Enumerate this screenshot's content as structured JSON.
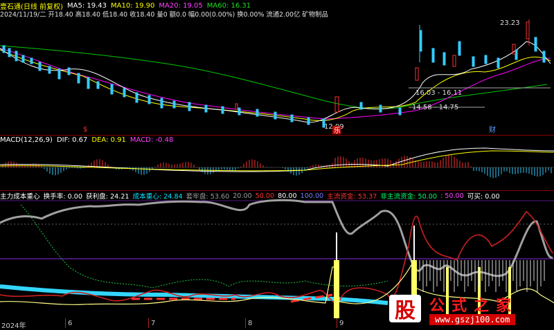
{
  "header": {
    "stock_name": "壹石通(日线 前复权)",
    "ma5": "MA5: 19.43",
    "ma10": "MA10: 19.90",
    "ma20": "MA20: 19.05",
    "ma60": "MA60: 16.31",
    "quote_line": "2024/11/19/二 开18.40 高18.40 低18.40 收18.40 量0 额0.0 幅0.00(0.00%) 换0.00% 流通2.00亿 矿物制品"
  },
  "main_chart": {
    "high_label": "23.23",
    "low_label": "12.09",
    "range_label_1": "16.03 - 16.11",
    "range_label_2": "14.58 - 14.75",
    "event_marks": [
      {
        "label": "$",
        "color": "#ff3030"
      },
      {
        "label": "乐",
        "color": "#ffffff"
      },
      {
        "label": "财",
        "color": "#5aa0ff"
      }
    ],
    "colors": {
      "ma5": "#ffffff",
      "ma10": "#ffff00",
      "ma20": "#ff00ff",
      "ma60": "#00cc00",
      "up": "#ff3030",
      "down": "#33ccff"
    }
  },
  "macd_panel": {
    "title": "MACD(12,26,9)",
    "dif": "DIF: 0.67",
    "dea": "DEA: 0.91",
    "macd": "MACD: -0.48"
  },
  "indicator_panel": {
    "title": "主力成本重心",
    "turnover": "换手率: 0.00",
    "profit": "获利盘: 24.21",
    "cost_center": "成本重心: 24.84",
    "trapped": "套牢盘: 53.60",
    "level_20": "20.00",
    "level_50": "50.00",
    "level_80": "80.00",
    "level_100": "100.00",
    "main_funds": "主流资金: 53.37",
    "non_main_funds": "非主流资金: 50.00",
    "level_50b": ": 50.00",
    "can_buy": "可买: 0.00"
  },
  "x_axis": {
    "labels": [
      "2024年",
      "6",
      "7",
      "8",
      "9"
    ]
  },
  "watermark": {
    "glyph": "股",
    "title": "公式之家",
    "url": "www.gszj100.com"
  }
}
